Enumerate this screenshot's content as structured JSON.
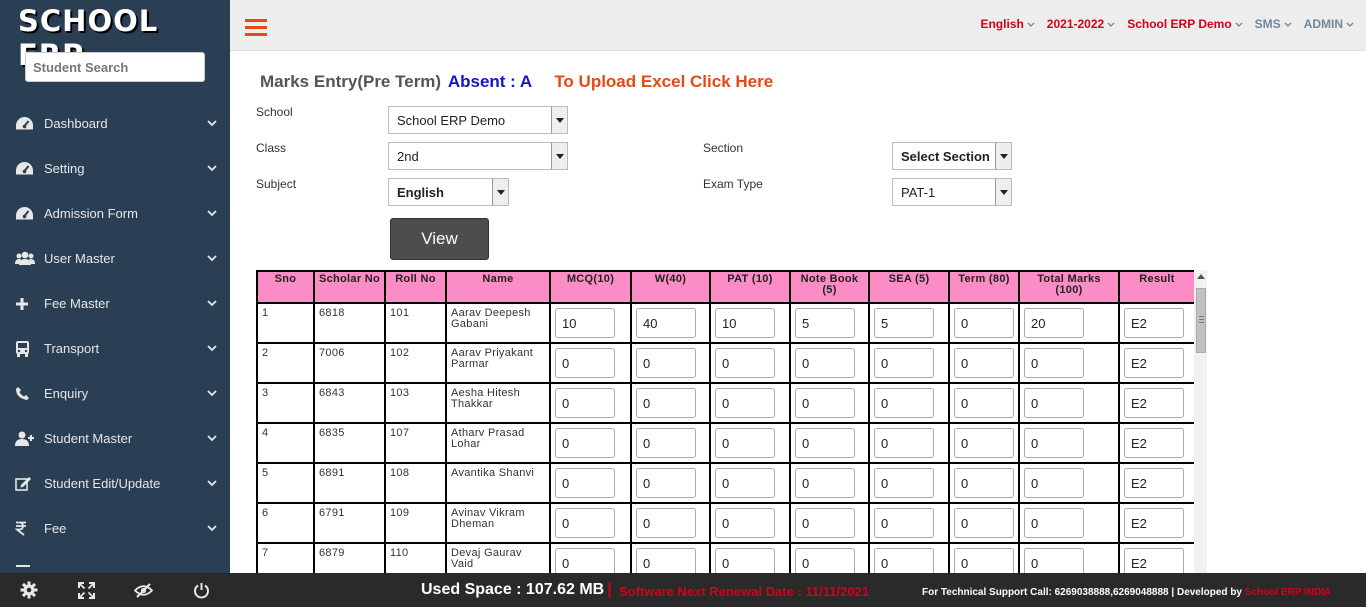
{
  "sidebar": {
    "logo": "SCHOOL ERP",
    "search_placeholder": "Student Search",
    "items": [
      {
        "label": "Dashboard",
        "icon": "dashboard-icon"
      },
      {
        "label": "Setting",
        "icon": "dashboard-icon"
      },
      {
        "label": "Admission Form",
        "icon": "dashboard-icon"
      },
      {
        "label": "User Master",
        "icon": "users-icon"
      },
      {
        "label": "Fee Master",
        "icon": "plus-icon"
      },
      {
        "label": "Transport",
        "icon": "bus-icon"
      },
      {
        "label": "Enquiry",
        "icon": "phone-icon"
      },
      {
        "label": "Student Master",
        "icon": "user-plus-icon"
      },
      {
        "label": "Student Edit/Update",
        "icon": "edit-icon"
      },
      {
        "label": "Fee",
        "icon": "rupee-icon"
      }
    ]
  },
  "topnav": {
    "language": "English",
    "session": "2021-2022",
    "school": "School ERP Demo",
    "sms": "SMS",
    "user": "ADMIN"
  },
  "page": {
    "title": "Marks Entry(Pre Term)",
    "absent_note": "Absent : A",
    "upload_link": "To Upload Excel Click Here"
  },
  "form": {
    "school_label": "School",
    "school_value": "School ERP Demo",
    "class_label": "Class",
    "class_value": "2nd",
    "section_label": "Section",
    "section_value": "Select Section",
    "subject_label": "Subject",
    "subject_value": "English",
    "exam_type_label": "Exam Type",
    "exam_type_value": "PAT-1",
    "view_button": "View"
  },
  "table": {
    "headers": [
      "Sno",
      "Scholar No",
      "Roll No",
      "Name",
      "MCQ(10)",
      "W(40)",
      "PAT (10)",
      "Note Book (5)",
      "SEA (5)",
      "Term (80)",
      "Total Marks (100)",
      "Result"
    ],
    "rows": [
      {
        "sno": "1",
        "scholar": "6818",
        "roll": "101",
        "name": "Aarav Deepesh Gabani",
        "marks": [
          "10",
          "40",
          "10",
          "5",
          "5",
          "0",
          "20"
        ],
        "result": "E2"
      },
      {
        "sno": "2",
        "scholar": "7006",
        "roll": "102",
        "name": "Aarav Priyakant Parmar",
        "marks": [
          "0",
          "0",
          "0",
          "0",
          "0",
          "0",
          "0"
        ],
        "result": "E2"
      },
      {
        "sno": "3",
        "scholar": "6843",
        "roll": "103",
        "name": "Aesha Hitesh Thakkar",
        "marks": [
          "0",
          "0",
          "0",
          "0",
          "0",
          "0",
          "0"
        ],
        "result": "E2"
      },
      {
        "sno": "4",
        "scholar": "6835",
        "roll": "107",
        "name": "Atharv Prasad Lohar",
        "marks": [
          "0",
          "0",
          "0",
          "0",
          "0",
          "0",
          "0"
        ],
        "result": "E2"
      },
      {
        "sno": "5",
        "scholar": "6891",
        "roll": "108",
        "name": "Avantika Shanvi",
        "marks": [
          "0",
          "0",
          "0",
          "0",
          "0",
          "0",
          "0"
        ],
        "result": "E2"
      },
      {
        "sno": "6",
        "scholar": "6791",
        "roll": "109",
        "name": "Avinav Vikram Dheman",
        "marks": [
          "0",
          "0",
          "0",
          "0",
          "0",
          "0",
          "0"
        ],
        "result": "E2"
      },
      {
        "sno": "7",
        "scholar": "6879",
        "roll": "110",
        "name": "Devaj Gaurav Vaid",
        "marks": [
          "0",
          "0",
          "0",
          "0",
          "0",
          "0",
          "0"
        ],
        "result": "E2"
      }
    ]
  },
  "footer": {
    "used_space": "Used Space : 107.62 MB",
    "separator": "|",
    "renewal": "Software Next Renewal Date : 11/11/2021",
    "support": "For Technical Support Call: 6269038888,6269048888 | Developed by",
    "developer": "School ERP INDIA"
  },
  "colors": {
    "sidebar_bg": "#2a3f54",
    "accent_red": "#d0021b",
    "header_pink": "#fc8cc5",
    "orange": "#e8490f",
    "absent_blue": "#1414c8"
  }
}
